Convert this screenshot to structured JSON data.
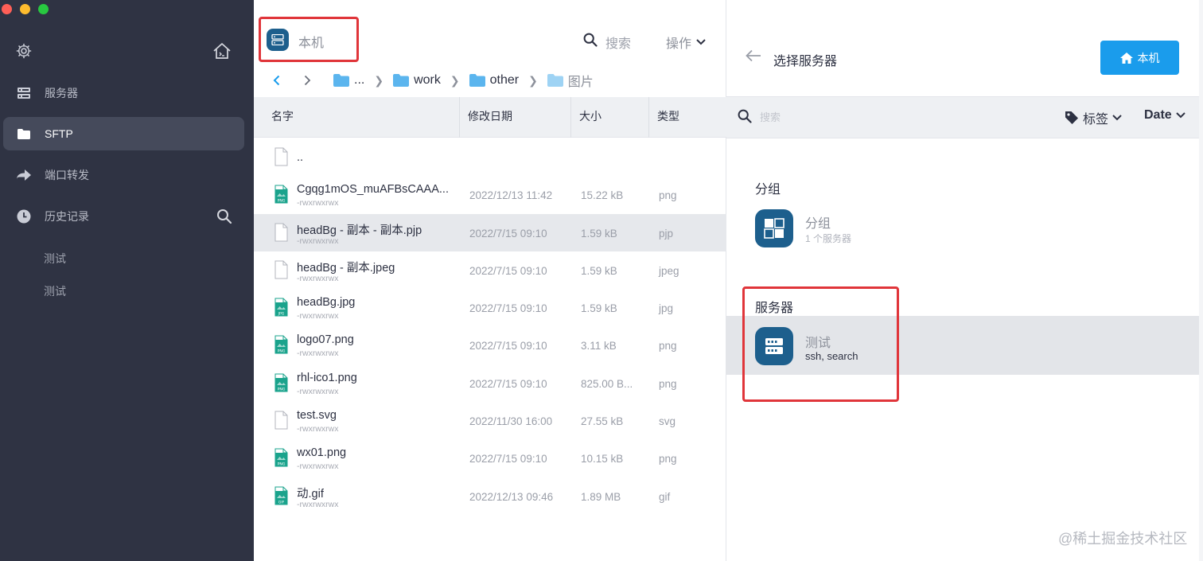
{
  "sidebar": {
    "items": [
      {
        "label": "服务器",
        "icon": "server-icon"
      },
      {
        "label": "SFTP",
        "icon": "folder-icon",
        "active": true
      },
      {
        "label": "端口转发",
        "icon": "forward-arrow-icon"
      },
      {
        "label": "历史记录",
        "icon": "clock-icon"
      }
    ],
    "history": [
      "测试",
      "测试"
    ]
  },
  "files": {
    "location": "本机",
    "search_label": "搜索",
    "actions_label": "操作",
    "breadcrumbs": [
      "...",
      "work",
      "other",
      "图片"
    ],
    "columns": [
      "名字",
      "修改日期",
      "大小",
      "类型"
    ],
    "rows": [
      {
        "name": "..",
        "perm": "",
        "date": "",
        "size": "",
        "type": "",
        "icon": "file-icon"
      },
      {
        "name": "Cgqg1mOS_muAFBsCAAA...",
        "perm": "-rwxrwxrwx",
        "date": "2022/12/13 11:42",
        "size": "15.22 kB",
        "type": "png",
        "icon": "png-file-icon"
      },
      {
        "name": "headBg - 副本 - 副本.pjp",
        "perm": "-rwxrwxrwx",
        "date": "2022/7/15 09:10",
        "size": "1.59 kB",
        "type": "pjp",
        "icon": "file-icon",
        "selected": true
      },
      {
        "name": "headBg - 副本.jpeg",
        "perm": "-rwxrwxrwx",
        "date": "2022/7/15 09:10",
        "size": "1.59 kB",
        "type": "jpeg",
        "icon": "file-icon"
      },
      {
        "name": "headBg.jpg",
        "perm": "-rwxrwxrwx",
        "date": "2022/7/15 09:10",
        "size": "1.59 kB",
        "type": "jpg",
        "icon": "jpg-file-icon"
      },
      {
        "name": "logo07.png",
        "perm": "-rwxrwxrwx",
        "date": "2022/7/15 09:10",
        "size": "3.11 kB",
        "type": "png",
        "icon": "png-file-icon"
      },
      {
        "name": "rhl-ico1.png",
        "perm": "-rwxrwxrwx",
        "date": "2022/7/15 09:10",
        "size": "825.00 B...",
        "type": "png",
        "icon": "png-file-icon"
      },
      {
        "name": "test.svg",
        "perm": "-rwxrwxrwx",
        "date": "2022/11/30 16:00",
        "size": "27.55 kB",
        "type": "svg",
        "icon": "file-icon"
      },
      {
        "name": "wx01.png",
        "perm": "-rwxrwxrwx",
        "date": "2022/7/15 09:10",
        "size": "10.15 kB",
        "type": "png",
        "icon": "png-file-icon"
      },
      {
        "name": "动.gif",
        "perm": "-rwxrwxrwx",
        "date": "2022/12/13 09:46",
        "size": "1.89 MB",
        "type": "gif",
        "icon": "gif-file-icon"
      }
    ]
  },
  "panel": {
    "title": "选择服务器",
    "local_button": "本机",
    "filter_placeholder": "搜索",
    "tag_label": "标签",
    "date_label": "Date",
    "group_section": "分组",
    "group": {
      "name": "分组",
      "sub": "1 个服务器"
    },
    "server_section": "服务器",
    "server": {
      "name": "测试",
      "sub": "ssh, search"
    }
  },
  "watermark": "@稀土掘金技术社区",
  "colors": {
    "sidebar_bg": "#2f3343",
    "accent_blue": "#1a9cec",
    "icon_tile": "#1d5f8d",
    "folder_blue": "#5bb5ee",
    "highlight_red": "#e0353a"
  }
}
